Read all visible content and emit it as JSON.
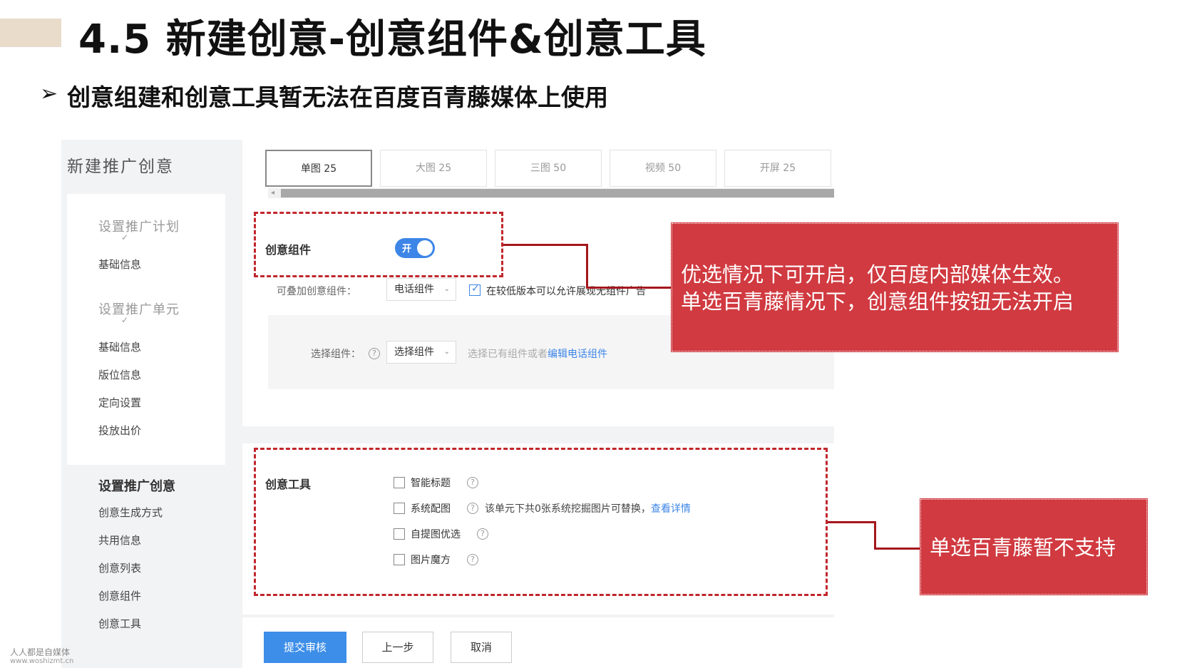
{
  "slide": {
    "title": "4.5 新建创意-创意组件&创意工具",
    "bullet_arrow": "➢",
    "bullet": "创意组建和创意工具暂无法在百度百青藤媒体上使用"
  },
  "sidebar": {
    "title": "新建推广创意",
    "check": "✓",
    "step1": "设置推广计划",
    "step1_items": [
      "基础信息"
    ],
    "step2": "设置推广单元",
    "step2_items": [
      "基础信息",
      "版位信息",
      "定向设置",
      "投放出价"
    ],
    "step3": "设置推广创意",
    "step3_items": [
      "创意生成方式",
      "共用信息",
      "创意列表",
      "创意组件",
      "创意工具"
    ]
  },
  "tabs": [
    {
      "label": "单图 25",
      "active": true
    },
    {
      "label": "大图 25",
      "active": false
    },
    {
      "label": "三图 50",
      "active": false
    },
    {
      "label": "视频 50",
      "active": false
    },
    {
      "label": "开屏 25",
      "active": false
    }
  ],
  "scroll_arrow": "◂",
  "component": {
    "label": "创意组件",
    "toggle_text": "开",
    "toggle_on": true,
    "stack_label": "可叠加创意组件：",
    "stack_select": "电话组件",
    "compat_label": "在较低版本可以允许展现无组件广告",
    "select_label": "选择组件：",
    "select_value": "选择组件",
    "hint_prefix": "选择已有组件或者",
    "hint_link": "编辑电话组件"
  },
  "tools": {
    "label": "创意工具",
    "options": [
      {
        "label": "智能标题",
        "checked": false
      },
      {
        "label": "系统配图",
        "checked": false
      },
      {
        "label": "自提图优选",
        "checked": false
      },
      {
        "label": "图片魔方",
        "checked": false
      }
    ],
    "system_note": "该单元下共0张系统挖掘图片可替换，",
    "system_link": "查看详情"
  },
  "icons": {
    "help": "?",
    "chevron": "⌄"
  },
  "buttons": {
    "submit": "提交审核",
    "prev": "上一步",
    "cancel": "取消"
  },
  "annotations": {
    "note1_line1": "优选情况下可开启，仅百度内部媒体生效。",
    "note1_line2": "单选百青藤情况下，创意组件按钮无法开启",
    "note2": "单选百青藤暂不支持"
  },
  "colors": {
    "accent": "#3d86e8",
    "annotation": "#d03a40",
    "dash": "#c0272d",
    "title_bar": "#e9dccb"
  },
  "watermark": {
    "line1": "人人都是自媒体",
    "line2": "www.woshizmt.cn"
  }
}
